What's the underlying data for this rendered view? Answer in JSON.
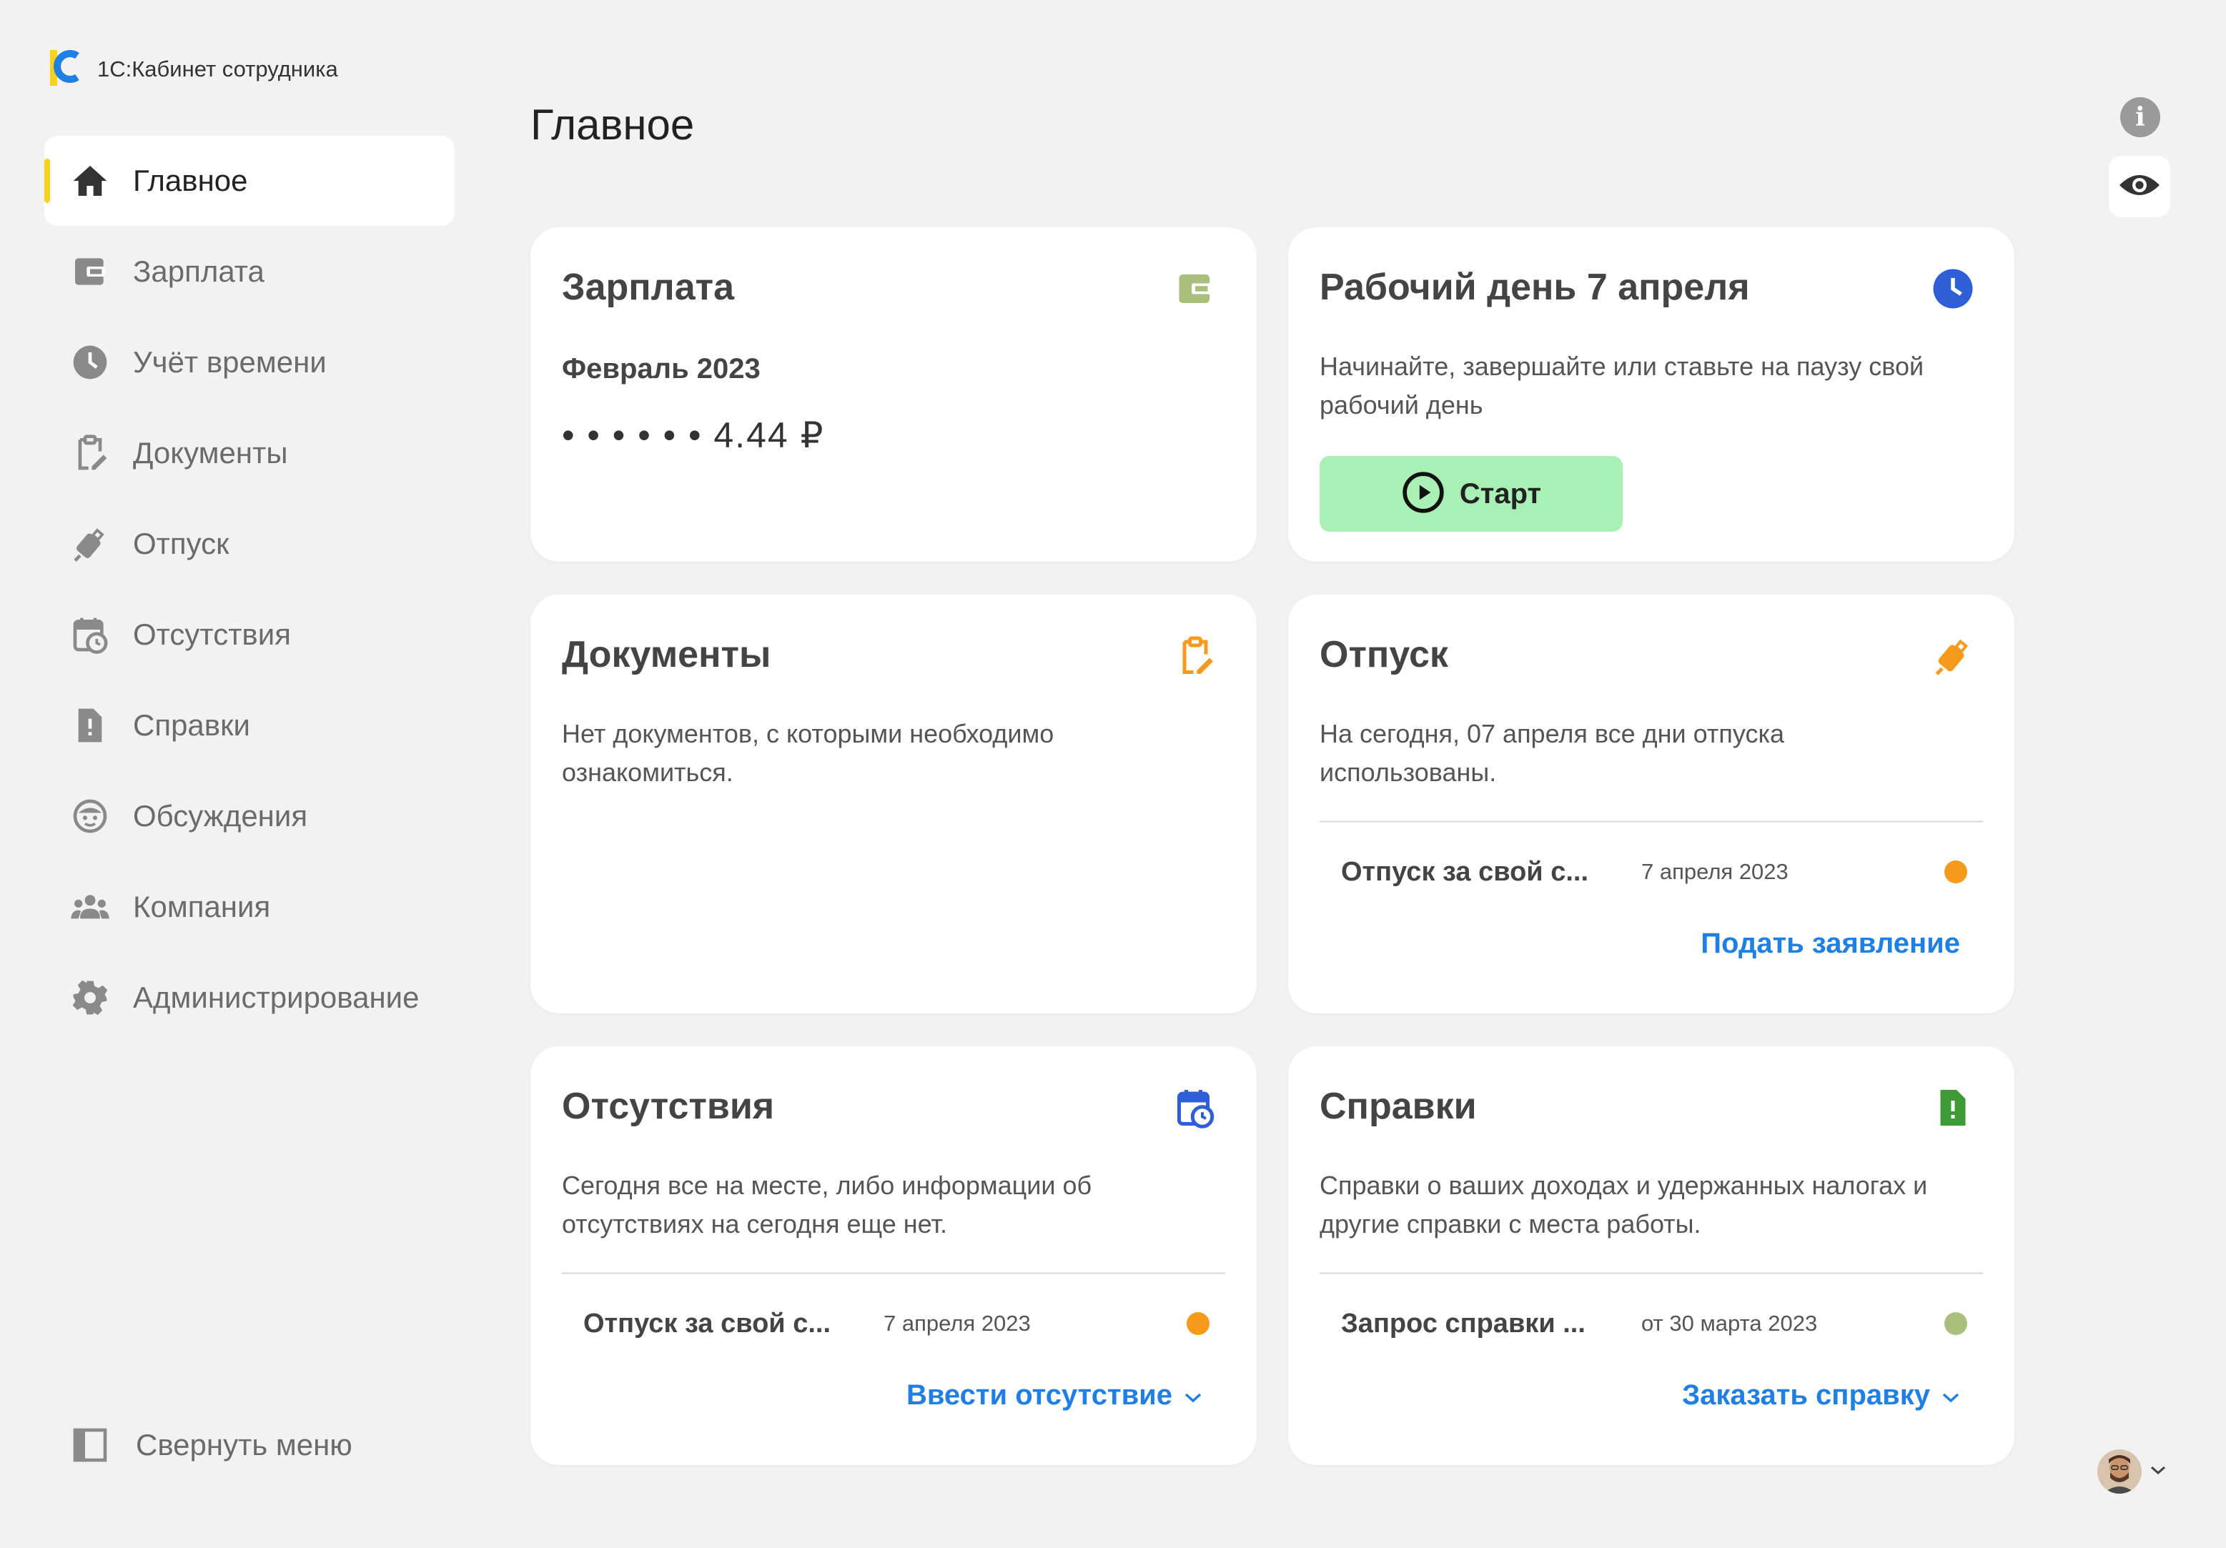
{
  "app": {
    "title": "1С:Кабинет сотрудника"
  },
  "colors": {
    "accent_yellow": "#f7d320",
    "link_blue": "#1f7fe3",
    "start_green": "#a8f0b4",
    "status_orange": "#f59a1b",
    "status_green": "#a9bf7d"
  },
  "sidebar": {
    "items": [
      {
        "label": "Главное",
        "icon": "home-icon",
        "active": true
      },
      {
        "label": "Зарплата",
        "icon": "wallet-icon"
      },
      {
        "label": "Учёт времени",
        "icon": "clock-icon"
      },
      {
        "label": "Документы",
        "icon": "clipboard-edit-icon"
      },
      {
        "label": "Отпуск",
        "icon": "suitcase-icon"
      },
      {
        "label": "Отсутствия",
        "icon": "calendar-clock-icon"
      },
      {
        "label": "Справки",
        "icon": "file-alert-icon"
      },
      {
        "label": "Обсуждения",
        "icon": "chat-face-icon"
      },
      {
        "label": "Компания",
        "icon": "people-icon"
      },
      {
        "label": "Администрирование",
        "icon": "gear-icon"
      }
    ],
    "collapse_label": "Свернуть меню"
  },
  "main": {
    "title": "Главное",
    "cards": {
      "salary": {
        "title": "Зарплата",
        "period": "Февраль 2023",
        "amount": "• • •  • • • 4.44 ₽"
      },
      "workday": {
        "title": "Рабочий день 7 апреля",
        "text": "Начинайте, завершайте или ставьте на паузу свой рабочий день",
        "button": "Старт"
      },
      "documents": {
        "title": "Документы",
        "text": "Нет документов, с которыми необходимо ознакомиться."
      },
      "vacation": {
        "title": "Отпуск",
        "text": "На сегодня, 07 апреля все дни отпуска использованы.",
        "row": {
          "title": "Отпуск за свой с...",
          "date": "7 апреля 2023"
        },
        "link": "Подать заявление"
      },
      "absences": {
        "title": "Отсутствия",
        "text": "Сегодня все на месте, либо информации об отсутствиях на сегодня еще нет.",
        "row": {
          "title": "Отпуск за свой с...",
          "date": "7 апреля 2023"
        },
        "link": "Ввести отсутствие"
      },
      "certificates": {
        "title": "Справки",
        "text": "Справки о ваших доходах и удержанных налогах и другие справки с места работы.",
        "row": {
          "title": "Запрос справки ...",
          "date": "от 30 марта 2023"
        },
        "link": "Заказать справку"
      }
    }
  }
}
